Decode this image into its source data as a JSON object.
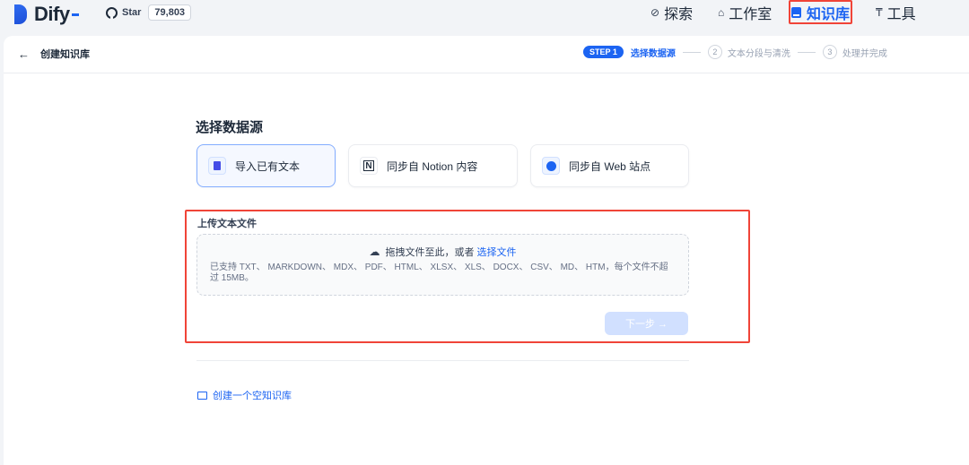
{
  "app": {
    "name": "Dify"
  },
  "github": {
    "star_label": "Star",
    "star_count": "79,803"
  },
  "nav": {
    "explore": "探索",
    "studio": "工作室",
    "knowledge": "知识库",
    "tools": "工具"
  },
  "subheader": {
    "back_label": "创建知识库",
    "steps": {
      "step1_pill": "STEP 1",
      "step1_label": "选择数据源",
      "step2_num": "2",
      "step2_label": "文本分段与清洗",
      "step3_num": "3",
      "step3_label": "处理并完成"
    }
  },
  "main": {
    "title": "选择数据源",
    "sources": [
      {
        "label": "导入已有文本",
        "icon": "file-icon"
      },
      {
        "label": "同步自 Notion 内容",
        "icon": "notion-icon"
      },
      {
        "label": "同步自 Web 站点",
        "icon": "web-icon"
      }
    ],
    "upload_label": "上传文本文件",
    "dropzone": {
      "text": "拖拽文件至此，或者 ",
      "link": "选择文件",
      "hint": "已支持 TXT、 MARKDOWN、 MDX、 PDF、 HTML、 XLSX、 XLS、 DOCX、 CSV、 MD、 HTM，每个文件不超过 15MB。"
    },
    "next_button": "下一步 →",
    "empty_kb_link": "创建一个空知识库"
  },
  "colors": {
    "accent": "#1c64f2",
    "highlight": "#f04438"
  }
}
